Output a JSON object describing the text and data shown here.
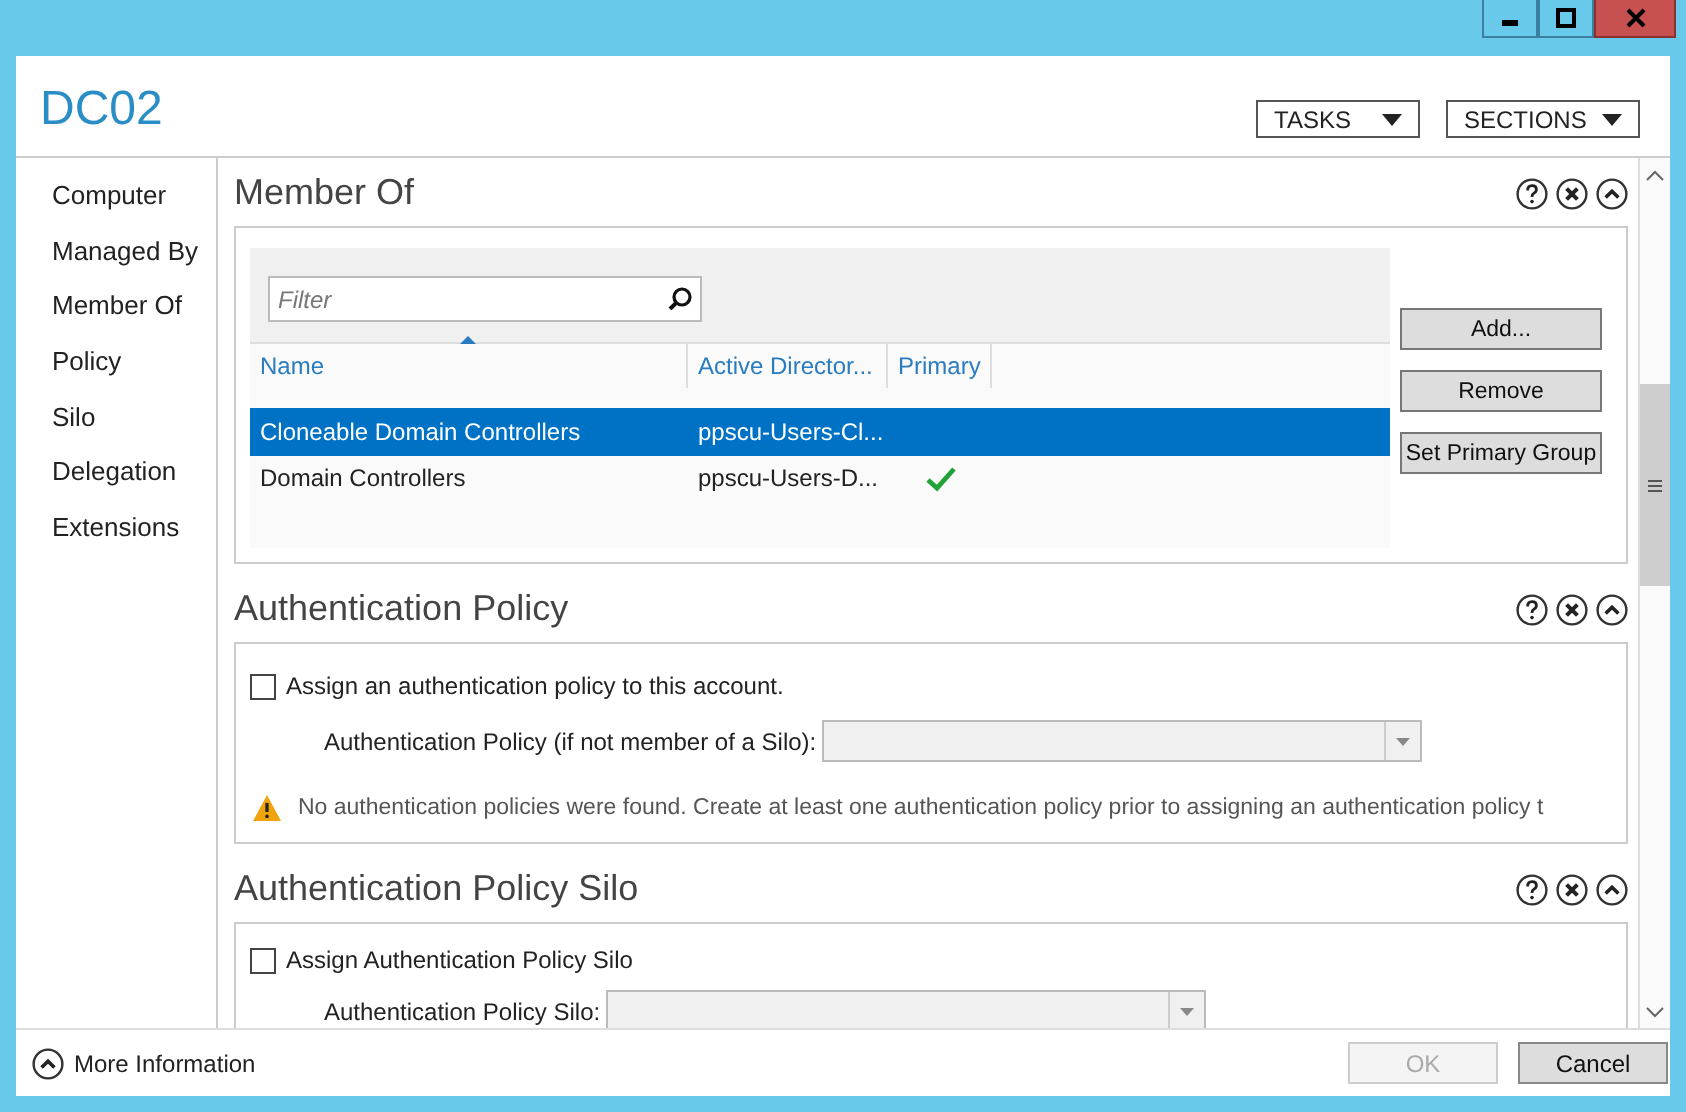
{
  "window": {
    "title": "DC02",
    "menus": [
      {
        "label": "TASKS"
      },
      {
        "label": "SECTIONS"
      }
    ]
  },
  "sidebar": {
    "items": [
      {
        "label": "Computer"
      },
      {
        "label": "Managed By"
      },
      {
        "label": "Member Of"
      },
      {
        "label": "Policy"
      },
      {
        "label": "Silo"
      },
      {
        "label": "Delegation"
      },
      {
        "label": "Extensions"
      }
    ]
  },
  "sections": [
    {
      "kind": "member_of",
      "title": "Member Of",
      "filter": {
        "placeholder": "Filter"
      },
      "columns": [
        {
          "label": "Name",
          "sorted": true
        },
        {
          "label": "Active Director...",
          "sorted": false
        },
        {
          "label": "Primary",
          "sorted": false
        }
      ],
      "rows": [
        {
          "name": "Cloneable Domain Controllers",
          "column_2": "ppscu-Users-Cl...",
          "primary": false,
          "selected": true
        },
        {
          "name": "Domain Controllers",
          "column_2": "ppscu-Users-D...",
          "primary": true,
          "selected": false
        }
      ],
      "buttons": [
        {
          "label": "Add..."
        },
        {
          "label": "Remove"
        },
        {
          "label": "Set Primary Group"
        }
      ]
    },
    {
      "kind": "policy",
      "title": "Authentication Policy",
      "checkbox": {
        "label": "Assign an authentication policy to this account.",
        "checked": false
      },
      "field_label": "Authentication Policy (if not member of a Silo):",
      "warning": "No authentication policies were found. Create at least one authentication policy prior to assigning an authentication policy t"
    },
    {
      "kind": "silo",
      "title": "Authentication Policy Silo",
      "checkbox": {
        "label": "Assign Authentication Policy Silo",
        "checked": false
      },
      "field_label": "Authentication Policy Silo:"
    }
  ],
  "footer": {
    "more_info": "More Information",
    "buttons": [
      {
        "label": "OK",
        "disabled": true
      },
      {
        "label": "Cancel",
        "disabled": false
      }
    ]
  }
}
